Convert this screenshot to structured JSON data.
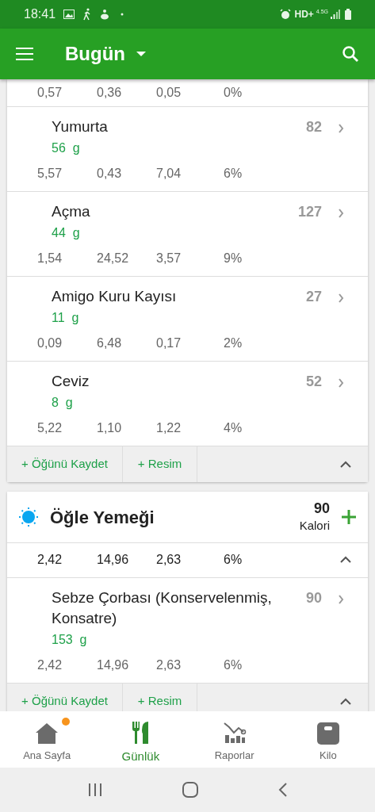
{
  "status_bar": {
    "time": "18:41",
    "network": "HD+",
    "network_type": "4.5G"
  },
  "app_bar": {
    "title": "Bugün"
  },
  "meals": [
    {
      "partial_row": {
        "nutrients": [
          "0,57",
          "0,36",
          "0,05",
          "0%"
        ]
      },
      "items": [
        {
          "name": "Yumurta",
          "calories": "82",
          "amount": "56  g",
          "nutrients": [
            "5,57",
            "0,43",
            "7,04",
            "6%"
          ]
        },
        {
          "name": "Açma",
          "calories": "127",
          "amount": "44  g",
          "nutrients": [
            "1,54",
            "24,52",
            "3,57",
            "9%"
          ]
        },
        {
          "name": "Amigo Kuru Kayısı",
          "calories": "27",
          "amount": "11  g",
          "nutrients": [
            "0,09",
            "6,48",
            "0,17",
            "2%"
          ]
        },
        {
          "name": "Ceviz",
          "calories": "52",
          "amount": "8  g",
          "nutrients": [
            "5,22",
            "1,10",
            "1,22",
            "4%"
          ]
        }
      ],
      "actions": [
        "+ Öğünü Kaydet",
        "+ Resim"
      ],
      "expanded": true
    },
    {
      "header": {
        "title": "Öğle Yemeği",
        "calories": "90",
        "unit": "Kalori"
      },
      "summary": [
        "2,42",
        "14,96",
        "2,63",
        "6%"
      ],
      "items": [
        {
          "name": "Sebze Çorbası (Konservelenmiş, Konsatre)",
          "calories": "90",
          "amount": "153  g",
          "nutrients": [
            "2,42",
            "14,96",
            "2,63",
            "6%"
          ]
        }
      ],
      "actions": [
        "+ Öğünü Kaydet",
        "+ Resim"
      ],
      "expanded": true
    }
  ],
  "bottom_nav": [
    {
      "kind": "home",
      "label": "Ana Sayfa",
      "selected": false,
      "notification": true
    },
    {
      "kind": "diary",
      "label": "Günlük",
      "selected": true,
      "notification": false
    },
    {
      "kind": "reports",
      "label": "Raporlar",
      "selected": false,
      "notification": false
    },
    {
      "kind": "weight",
      "label": "Kilo",
      "selected": false,
      "notification": false
    }
  ]
}
